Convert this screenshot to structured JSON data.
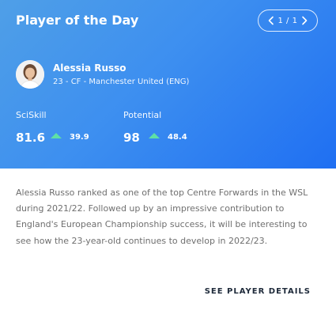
{
  "card": {
    "title": "Player of the Day",
    "pager": {
      "text": "1 / 1",
      "prev_icon": "chevron-left-icon",
      "next_icon": "chevron-right-icon"
    }
  },
  "player": {
    "name": "Alessia Russo",
    "meta": "23 - CF - Manchester United (ENG)",
    "avatar_icon": "player-photo"
  },
  "stats": [
    {
      "label": "SciSkill",
      "value": "81.6",
      "delta": "39.9",
      "trend_icon": "up-arrow-icon"
    },
    {
      "label": "Potential",
      "value": "98",
      "delta": "48.4",
      "trend_icon": "up-arrow-icon"
    }
  ],
  "description": "Alessia Russo ranked as one of the top Centre Forwards in the WSL during 2021/22. Followed up by an impressive contribution to England's European Championship success, it will be interesting to see how the 23-year-old continues to develop in 2022/23.",
  "cta": {
    "label": "SEE PLAYER DETAILS"
  },
  "colors": {
    "header_start": "#4f9fe7",
    "header_end": "#1f6ff2",
    "trend_up": "#5ee0a6",
    "body_text": "#6f6f6f",
    "link_text": "#1e2a3a"
  }
}
